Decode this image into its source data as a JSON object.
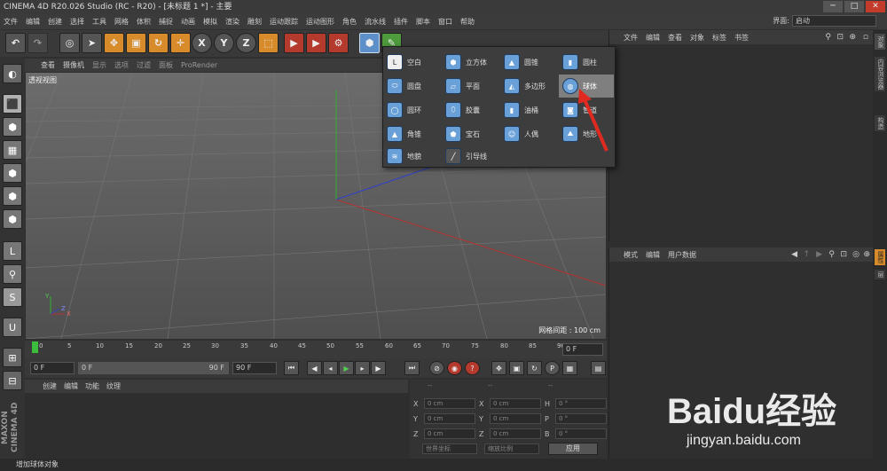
{
  "window": {
    "title": "CINEMA 4D R20.026 Studio (RC - R20) - [未标题 1 *] - 主要",
    "btn_min": "─",
    "btn_max": "□",
    "btn_close": "✕"
  },
  "menubar": {
    "items": [
      "文件",
      "编辑",
      "创建",
      "选择",
      "工具",
      "网格",
      "体积",
      "捕捉",
      "动画",
      "模拟",
      "渲染",
      "雕刻",
      "运动跟踪",
      "运动图形",
      "角色",
      "流水线",
      "插件",
      "脚本",
      "窗口",
      "帮助"
    ],
    "layout_label": "界面:",
    "layout_value": "启动"
  },
  "viewport": {
    "menu": [
      "查看",
      "摄像机",
      "显示",
      "选项",
      "过滤",
      "面板",
      "ProRender"
    ],
    "label": "透视视图",
    "grid_spacing": "网格间距 : 100 cm",
    "axis_y": "Y",
    "axis_z": "Z",
    "axis_x": "X"
  },
  "timeline": {
    "ticks": [
      "0",
      "5",
      "10",
      "15",
      "20",
      "25",
      "30",
      "35",
      "40",
      "45",
      "50",
      "55",
      "60",
      "65",
      "70",
      "75",
      "80",
      "85",
      "90"
    ],
    "current_frame": "0 F"
  },
  "playbar": {
    "start": "0 F",
    "range_start": "0 F",
    "range_end": "90 F",
    "end": "90 F"
  },
  "material": {
    "menu": [
      "创建",
      "编辑",
      "功能",
      "纹理"
    ]
  },
  "coords": {
    "headers": [
      "--",
      "--",
      "--"
    ],
    "rows": [
      {
        "a": "X",
        "av": "0 cm",
        "b": "X",
        "bv": "0 cm",
        "c": "H",
        "cv": "0 °"
      },
      {
        "a": "Y",
        "av": "0 cm",
        "b": "Y",
        "bv": "0 cm",
        "c": "P",
        "cv": "0 °"
      },
      {
        "a": "Z",
        "av": "0 cm",
        "b": "Z",
        "bv": "0 cm",
        "c": "B",
        "cv": "0 °"
      }
    ],
    "mode1": "世界坐标",
    "mode2": "缩放比例",
    "apply": "应用"
  },
  "object_manager": {
    "menu": [
      "文件",
      "编辑",
      "查看",
      "对象",
      "标签",
      "书签"
    ]
  },
  "attribute_manager": {
    "menu": [
      "模式",
      "编辑",
      "用户数据"
    ]
  },
  "right_tabs": [
    "对象",
    "内容浏览器",
    "构造",
    "属性",
    "层"
  ],
  "status": "增加球体对象",
  "primitives": [
    [
      "空白",
      "立方体",
      "圆锥",
      "圆柱"
    ],
    [
      "圆盘",
      "平面",
      "多边形",
      "球体"
    ],
    [
      "圆环",
      "胶囊",
      "油桶",
      "管道"
    ],
    [
      "角锥",
      "宝石",
      "人偶",
      "地形"
    ],
    [
      "地貌",
      "引导线"
    ]
  ],
  "selected_primitive": "球体",
  "branding": {
    "maxon": "MAXON CINEMA 4D",
    "watermark_brand": "Baidu经验",
    "watermark_url": "jingyan.baidu.com"
  },
  "colors": {
    "accent_blue": "#6aa0d8",
    "highlight": "#7f7f7f",
    "arrow_red": "#e02a20"
  }
}
